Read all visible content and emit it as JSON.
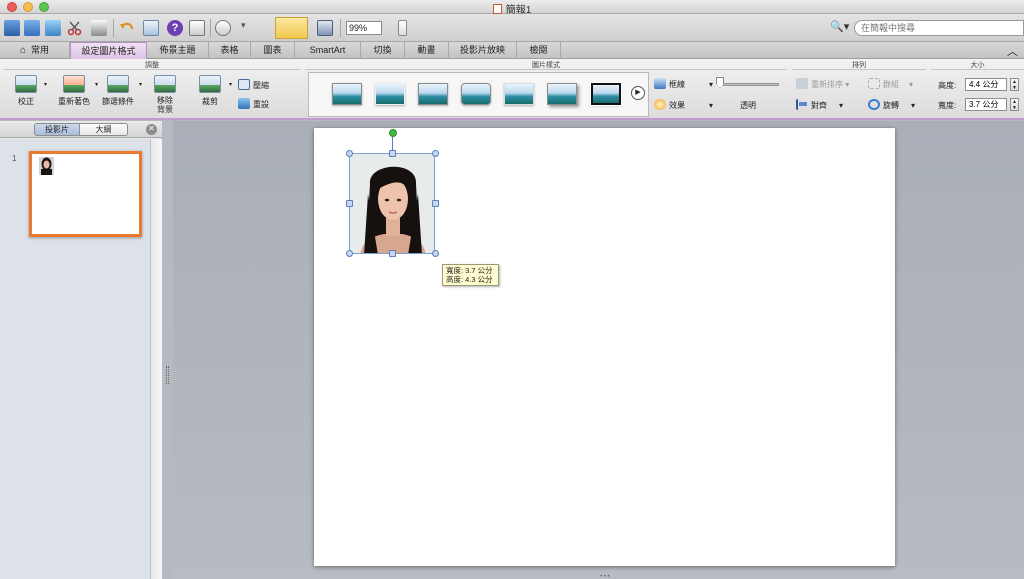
{
  "window": {
    "title": "簡報1"
  },
  "toolbar": {
    "zoom": "99%"
  },
  "search": {
    "placeholder": "在簡報中搜尋"
  },
  "tabs": [
    {
      "label": "常用"
    },
    {
      "label": "設定圖片格式"
    },
    {
      "label": "佈景主題"
    },
    {
      "label": "表格"
    },
    {
      "label": "圖表"
    },
    {
      "label": "SmartArt"
    },
    {
      "label": "切換"
    },
    {
      "label": "動畫"
    },
    {
      "label": "投影片放映"
    },
    {
      "label": "檢閱"
    }
  ],
  "ribbon": {
    "adjust": {
      "title": "調整",
      "correct": "校正",
      "recolor": "重新著色",
      "filters": "篩選條件",
      "remove_bg_line1": "移除",
      "remove_bg_line2": "背景",
      "crop": "裁剪",
      "compress": "壓縮",
      "reset": "重設"
    },
    "styles": {
      "title": "圖片樣式",
      "border": "框線",
      "effects": "效果",
      "transparency": "透明"
    },
    "arrange": {
      "title": "排列",
      "reorder": "重新排序",
      "group": "群組",
      "align": "對齊",
      "rotate": "旋轉"
    },
    "size": {
      "title": "大小",
      "height_label": "高度:",
      "height_value": "4.4 公分",
      "width_label": "寬度:",
      "width_value": "3.7 公分"
    }
  },
  "pane": {
    "tab_slides": "投影片",
    "tab_outline": "大綱",
    "close": "✕",
    "slide_number": "1"
  },
  "tooltip": {
    "width": "寬度: 3.7 公分",
    "height": "高度: 4.3 公分"
  },
  "colors": {
    "active_tab": "#ddc3e6",
    "selected_slide_border": "#ea7a2e",
    "rotation_handle": "#45b945"
  }
}
